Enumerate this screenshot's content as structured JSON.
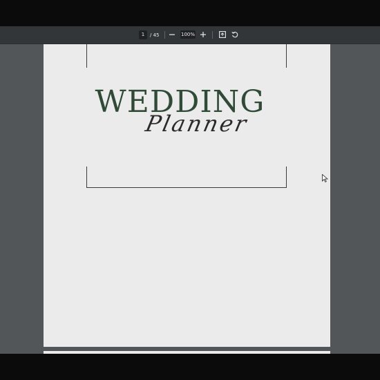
{
  "toolbar": {
    "page_current": "1",
    "page_total": "/ 45",
    "zoom": "100%",
    "zoom_out_icon": "minus-icon",
    "zoom_in_icon": "plus-icon",
    "fit_icon": "fit-to-page-icon",
    "rotate_icon": "rotate-icon"
  },
  "document": {
    "title": "WEDDING",
    "subtitle": "Planner"
  },
  "colors": {
    "toolbar_bg": "#323639",
    "viewer_bg": "#525659",
    "page_bg": "#ebebeb",
    "title_green": "#2f4a36"
  }
}
